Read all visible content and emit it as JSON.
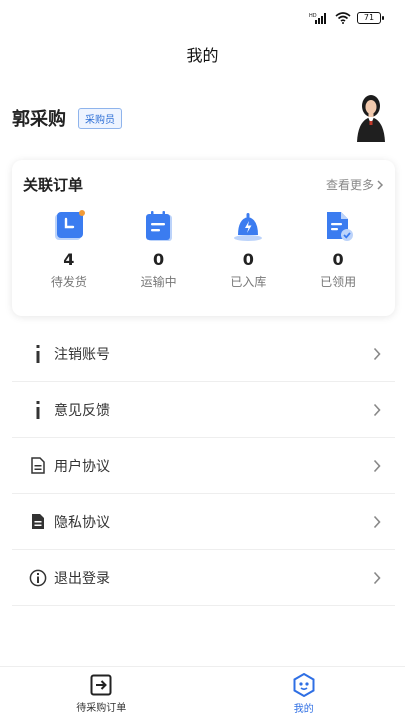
{
  "status_bar": {
    "battery": "71",
    "network_label": "HD"
  },
  "header": {
    "title": "我的"
  },
  "profile": {
    "name": "郭采购",
    "role": "采购员"
  },
  "orders": {
    "title": "关联订单",
    "view_more": "查看更多",
    "stats": [
      {
        "count": "4",
        "label": "待发货",
        "icon": "clock-icon"
      },
      {
        "count": "0",
        "label": "运输中",
        "icon": "calendar-icon"
      },
      {
        "count": "0",
        "label": "已入库",
        "icon": "bell-icon"
      },
      {
        "count": "0",
        "label": "已领用",
        "icon": "document-check-icon"
      }
    ]
  },
  "menu": {
    "items": [
      {
        "label": "注销账号",
        "icon": "info-icon"
      },
      {
        "label": "意见反馈",
        "icon": "info-icon"
      },
      {
        "label": "用户协议",
        "icon": "document-outline-icon"
      },
      {
        "label": "隐私协议",
        "icon": "document-filled-icon"
      },
      {
        "label": "退出登录",
        "icon": "info-circle-icon"
      }
    ]
  },
  "tabs": [
    {
      "label": "待采购订单",
      "icon": "arrow-box-icon",
      "active": false
    },
    {
      "label": "我的",
      "icon": "hexagon-face-icon",
      "active": true
    }
  ],
  "colors": {
    "accent": "#2f6fe4",
    "icon_blue": "#3b7cf0",
    "badge_orange": "#f29b38"
  }
}
